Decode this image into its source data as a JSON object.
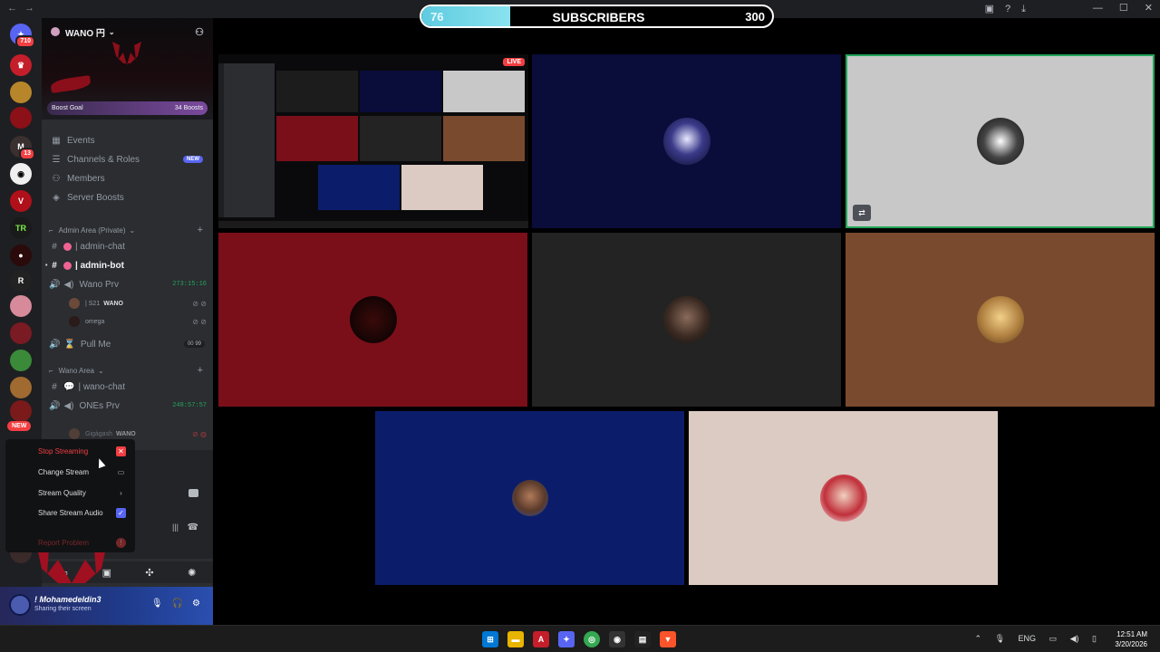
{
  "window": {
    "title": "Wano 円"
  },
  "subscriber_goal": {
    "current": "76",
    "label": "SUBSCRIBERS",
    "goal": "300",
    "progress_fraction": 0.253
  },
  "server_rail": {
    "badges": {
      "dm": "710",
      "server4": "13"
    },
    "new_pill": "NEW",
    "icons": [
      "discord-home-icon",
      "server-icon",
      "server-icon",
      "server-icon",
      "server-icon",
      "server-icon",
      "server-icon"
    ]
  },
  "server": {
    "name": "WANO 円",
    "boost_goal_label": "Boost Goal",
    "boost_count": "34 Boosts"
  },
  "menu": [
    {
      "label": "Events",
      "icon": "calendar-icon"
    },
    {
      "label": "Channels & Roles",
      "icon": "list-icon",
      "tag": "NEW"
    },
    {
      "label": "Members",
      "icon": "members-icon"
    },
    {
      "label": "Server Boosts",
      "icon": "boost-icon"
    }
  ],
  "categories": {
    "admin": "Admin Area (Private)",
    "wano": "Wano Area"
  },
  "channels": {
    "admin_chat": "| admin-chat",
    "admin_bot": "| admin-bot",
    "wano_prv": "Wano Prv",
    "wano_prv_timer": "273:15:16",
    "pull_me": "Pull Me",
    "pull_me_count_a": "00",
    "pull_me_count_b": "99",
    "wano_chat": "| wano-chat",
    "ones_prv": "ONEs Prv",
    "ones_prv_timer": "248:57:57"
  },
  "voice_users": {
    "user1_name": "| S21",
    "user1_tag": "WANO",
    "user2_name": "omega",
    "user3_name": "Gigàgash",
    "user3_tag": "WANO"
  },
  "stream_menu": {
    "stop": "Stop Streaming",
    "change": "Change Stream",
    "quality": "Stream Quality",
    "audio": "Share Stream Audio",
    "report": "Report Problem"
  },
  "user": {
    "name": "! Mohamedeldin3",
    "status": "Sharing their screen"
  },
  "stage": {
    "live_label": "LIVE"
  },
  "colors": {
    "tile_navy": "#0a0c3a",
    "tile_grey": "#c8c8c8",
    "tile_red": "#7a0f1a",
    "tile_dark": "#232323",
    "tile_brown": "#7a4a2e",
    "tile_blue": "#0b1d6a",
    "tile_pink": "#dccbc3",
    "accent_green": "#23a55a"
  },
  "taskbar": {
    "lang": "ENG",
    "time": "12:51 AM",
    "date": "3/20/2026"
  }
}
